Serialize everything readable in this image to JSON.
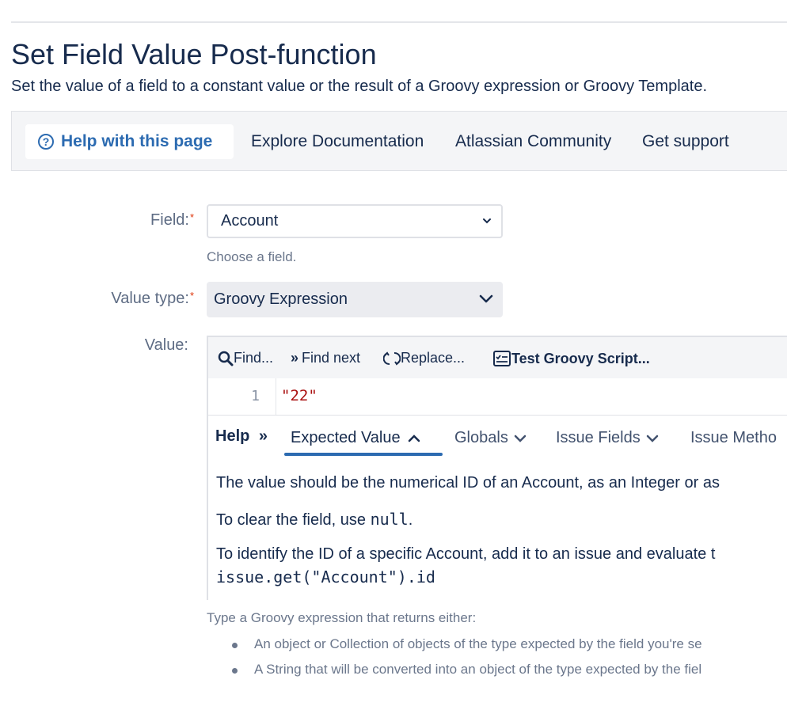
{
  "page": {
    "title": "Set Field Value Post-function",
    "description": "Set the value of a field to a constant value or the result of a Groovy expression or Groovy Template."
  },
  "helpbar": {
    "help_button": "Help with this page",
    "links": [
      "Explore Documentation",
      "Atlassian Community",
      "Get support"
    ]
  },
  "form": {
    "field_label": "Field:",
    "field_value": "Account",
    "field_hint": "Choose a field.",
    "value_type_label": "Value type:",
    "value_type_value": "Groovy Expression",
    "value_label": "Value:",
    "required_mark": "*"
  },
  "editor": {
    "toolbar": {
      "find": "Find...",
      "find_next": "Find next",
      "replace": "Replace...",
      "test": "Test Groovy Script..."
    },
    "line_number": "1",
    "code": "\"22\"",
    "help_label": "Help",
    "tabs": [
      {
        "label": "Expected Value",
        "active": true
      },
      {
        "label": "Globals",
        "active": false
      },
      {
        "label": "Issue Fields",
        "active": false
      },
      {
        "label": "Issue Metho",
        "active": false
      }
    ],
    "help_text": {
      "line1": "The value should be the numerical ID of an Account, as an Integer or as",
      "line2_prefix": "To clear the field, use ",
      "line2_code": "null",
      "line2_suffix": ".",
      "line3": "To identify the ID of a specific Account, add it to an issue and evaluate t",
      "line4_code": "issue.get(\"Account\").id"
    }
  },
  "value_description": {
    "intro": "Type a Groovy expression that returns either:",
    "bullets": [
      "An object or Collection of objects of the type expected by the field you're se",
      "A String that will be converted into an object of the type expected by the fiel"
    ]
  },
  "colors": {
    "accent": "#2c6bb1",
    "required": "#de350b",
    "text": "#172b4d",
    "muted": "#6b778c"
  }
}
